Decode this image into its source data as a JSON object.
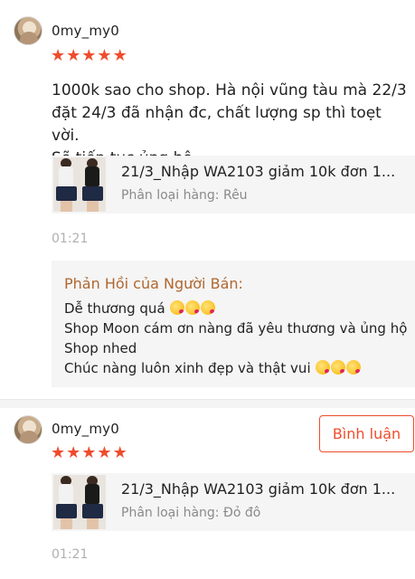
{
  "reviews": [
    {
      "username": "0my_my0",
      "rating": 5,
      "stars": [
        "★",
        "★",
        "★",
        "★",
        "★"
      ],
      "comment_lines": [
        "1000k sao cho shop. Hà nội vũng tàu mà 22/3",
        "đặt 24/3 đã nhận đc, chất lượng sp thì toẹt vời.",
        "Sẽ tiếp tục ủng hộ"
      ],
      "product": {
        "name": "21/3_Nhập WA2103 giảm 10k đơn 1...",
        "variant": "Phân loại hàng: Rêu"
      },
      "time": "01:21",
      "seller_reply": {
        "title": "Phản Hồi của Người Bán:",
        "lines": [
          "Dễ thương quá",
          "Shop Moon cám ơn nàng đã yêu thương và ủng hộ",
          "Shop nhed",
          "Chúc nàng luôn xinh đẹp và thật vui"
        ]
      }
    },
    {
      "username": "0my_my0",
      "rating": 5,
      "stars": [
        "★",
        "★",
        "★",
        "★",
        "★"
      ],
      "product": {
        "name": "21/3_Nhập WA2103 giảm 10k đơn 1...",
        "variant": "Phân loại hàng: Đỏ đô"
      },
      "time": "01:21",
      "comment_button": "Bình luận"
    }
  ],
  "icons": {
    "star": "star-icon",
    "emoji": "face-blowing-kiss-icon"
  },
  "colors": {
    "accent": "#ee4d2d",
    "reply_title": "#b0672f",
    "muted": "#8a8a8a"
  }
}
